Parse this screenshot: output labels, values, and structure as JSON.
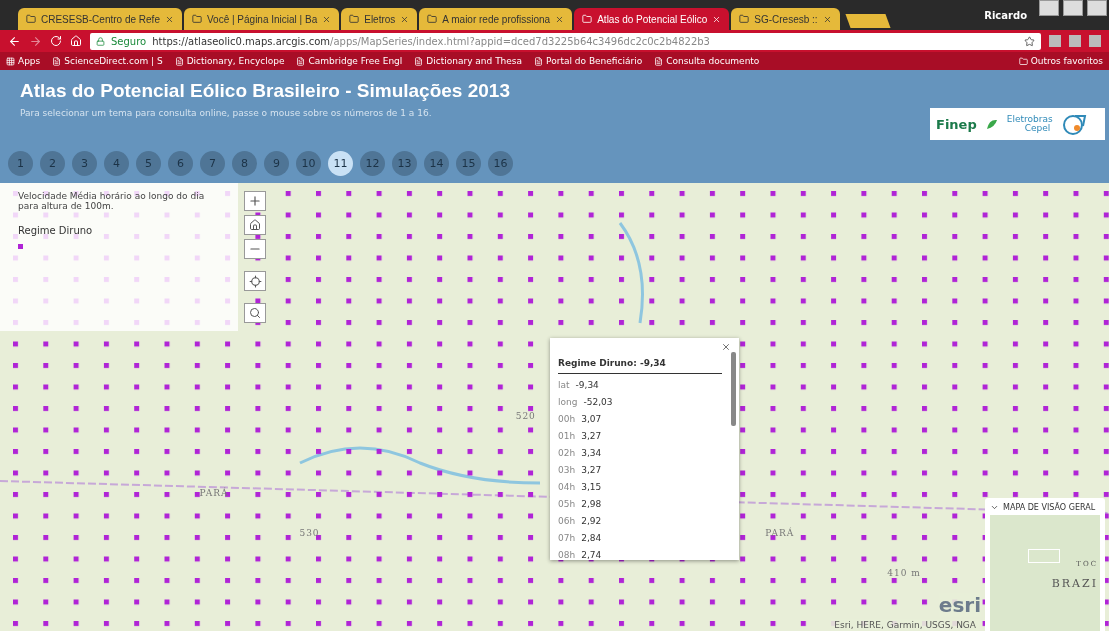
{
  "browser": {
    "tabs": [
      {
        "title": "CRESESB-Centro de Refe",
        "selected": false
      },
      {
        "title": "Você | Página Inicial | Ba",
        "selected": false
      },
      {
        "title": "Eletros",
        "selected": false
      },
      {
        "title": "A maior rede profissiona",
        "selected": false
      },
      {
        "title": "Atlas do Potencial Eólico",
        "selected": true
      },
      {
        "title": "SG-Cresesb ::",
        "selected": false
      }
    ],
    "profile": "Ricardo",
    "secure_label": "Seguro",
    "url_host": "https://atlaseolic0.maps.arcgis.com",
    "url_path": "/apps/MapSeries/index.html?appid=dced7d3225b64c3496dc2c0c2b4822b3",
    "bookmarks": [
      "Apps",
      "ScienceDirect.com | S",
      "Dictionary, Encyclope",
      "Cambridge Free Engl",
      "Dictionary and Thesa",
      "Portal do Beneficiário",
      "Consulta documento"
    ],
    "other_bookmarks": "Outros favoritos"
  },
  "header": {
    "title": "Atlas do Potencial Eólico Brasileiro - Simulações 2013",
    "subtitle": "Para selecionar um tema para consulta online, passe o mouse sobre os números de 1 a 16.",
    "logos": {
      "finep": "Finep",
      "eletrobras": "Eletrobras",
      "cepel": "Cepel"
    },
    "themes": [
      {
        "label": "1",
        "selected": false
      },
      {
        "label": "2",
        "selected": false
      },
      {
        "label": "3",
        "selected": false
      },
      {
        "label": "4",
        "selected": false
      },
      {
        "label": "5",
        "selected": false
      },
      {
        "label": "6",
        "selected": false
      },
      {
        "label": "7",
        "selected": false
      },
      {
        "label": "8",
        "selected": false
      },
      {
        "label": "9",
        "selected": false
      },
      {
        "label": "10",
        "selected": false
      },
      {
        "label": "11",
        "selected": true
      },
      {
        "label": "12",
        "selected": false
      },
      {
        "label": "13",
        "selected": false
      },
      {
        "label": "14",
        "selected": false
      },
      {
        "label": "15",
        "selected": false
      },
      {
        "label": "16",
        "selected": false
      }
    ]
  },
  "legend": {
    "description": "Velocidade Média horário ao longo do dia para altura de 100m.",
    "title": "Regime Diruno",
    "color": "#b024d6"
  },
  "map": {
    "labels": [
      "PARÁ",
      "PARÁ",
      "530",
      "520",
      "410 m"
    ],
    "attribution": "Esri, HERE, Garmin, USGS, NGA",
    "esri": "esri"
  },
  "popup": {
    "title": "Regime Diruno: -9,34",
    "rows": [
      {
        "label": "lat",
        "value": "-9,34"
      },
      {
        "label": "long",
        "value": "-52,03"
      },
      {
        "label": "00h",
        "value": "3,07"
      },
      {
        "label": "01h",
        "value": "3,27"
      },
      {
        "label": "02h",
        "value": "3,34"
      },
      {
        "label": "03h",
        "value": "3,27"
      },
      {
        "label": "04h",
        "value": "3,15"
      },
      {
        "label": "05h",
        "value": "2,98"
      },
      {
        "label": "06h",
        "value": "2,92"
      },
      {
        "label": "07h",
        "value": "2,84"
      },
      {
        "label": "08h",
        "value": "2,74"
      }
    ]
  },
  "overview": {
    "title": "MAPA DE VISÃO GERAL",
    "expanded": true,
    "labels": [
      "TOC",
      "BRAZI"
    ]
  }
}
